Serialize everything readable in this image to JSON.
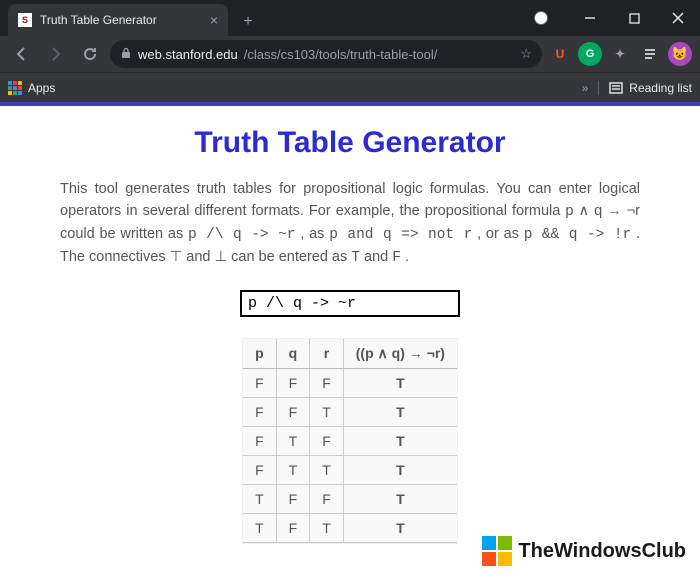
{
  "browser": {
    "tab_title": "Truth Table Generator",
    "url_domain": "web.stanford.edu",
    "url_path": "/class/cs103/tools/truth-table-tool/",
    "apps_label": "Apps",
    "reading_list_label": "Reading list",
    "ext_u": "U",
    "ext_g": "G"
  },
  "page": {
    "title": "Truth Table Generator",
    "intro_a": "This tool generates truth tables for propositional logic formulas. You can enter logical operators in several different formats. For example, the propositional formula p ∧ q → ¬r could be written as ",
    "code1": "p /\\ q -> ~r",
    "intro_b": ", as ",
    "code2": "p and q => not r",
    "intro_c": ", or as ",
    "code3": "p && q -> !r",
    "intro_d": ". The connectives ⊤ and ⊥ can be entered as ",
    "code4": "T",
    "intro_e": " and ",
    "code5": "F",
    "intro_f": ".",
    "formula_value": "p /\\ q -> ~r",
    "table": {
      "headers": [
        "p",
        "q",
        "r",
        "((p ∧ q) → ¬r)"
      ],
      "rows": [
        [
          "F",
          "F",
          "F",
          "T"
        ],
        [
          "F",
          "F",
          "T",
          "T"
        ],
        [
          "F",
          "T",
          "F",
          "T"
        ],
        [
          "F",
          "T",
          "T",
          "T"
        ],
        [
          "T",
          "F",
          "F",
          "T"
        ],
        [
          "T",
          "F",
          "T",
          "T"
        ]
      ]
    }
  },
  "watermark": "TheWindowsClub"
}
